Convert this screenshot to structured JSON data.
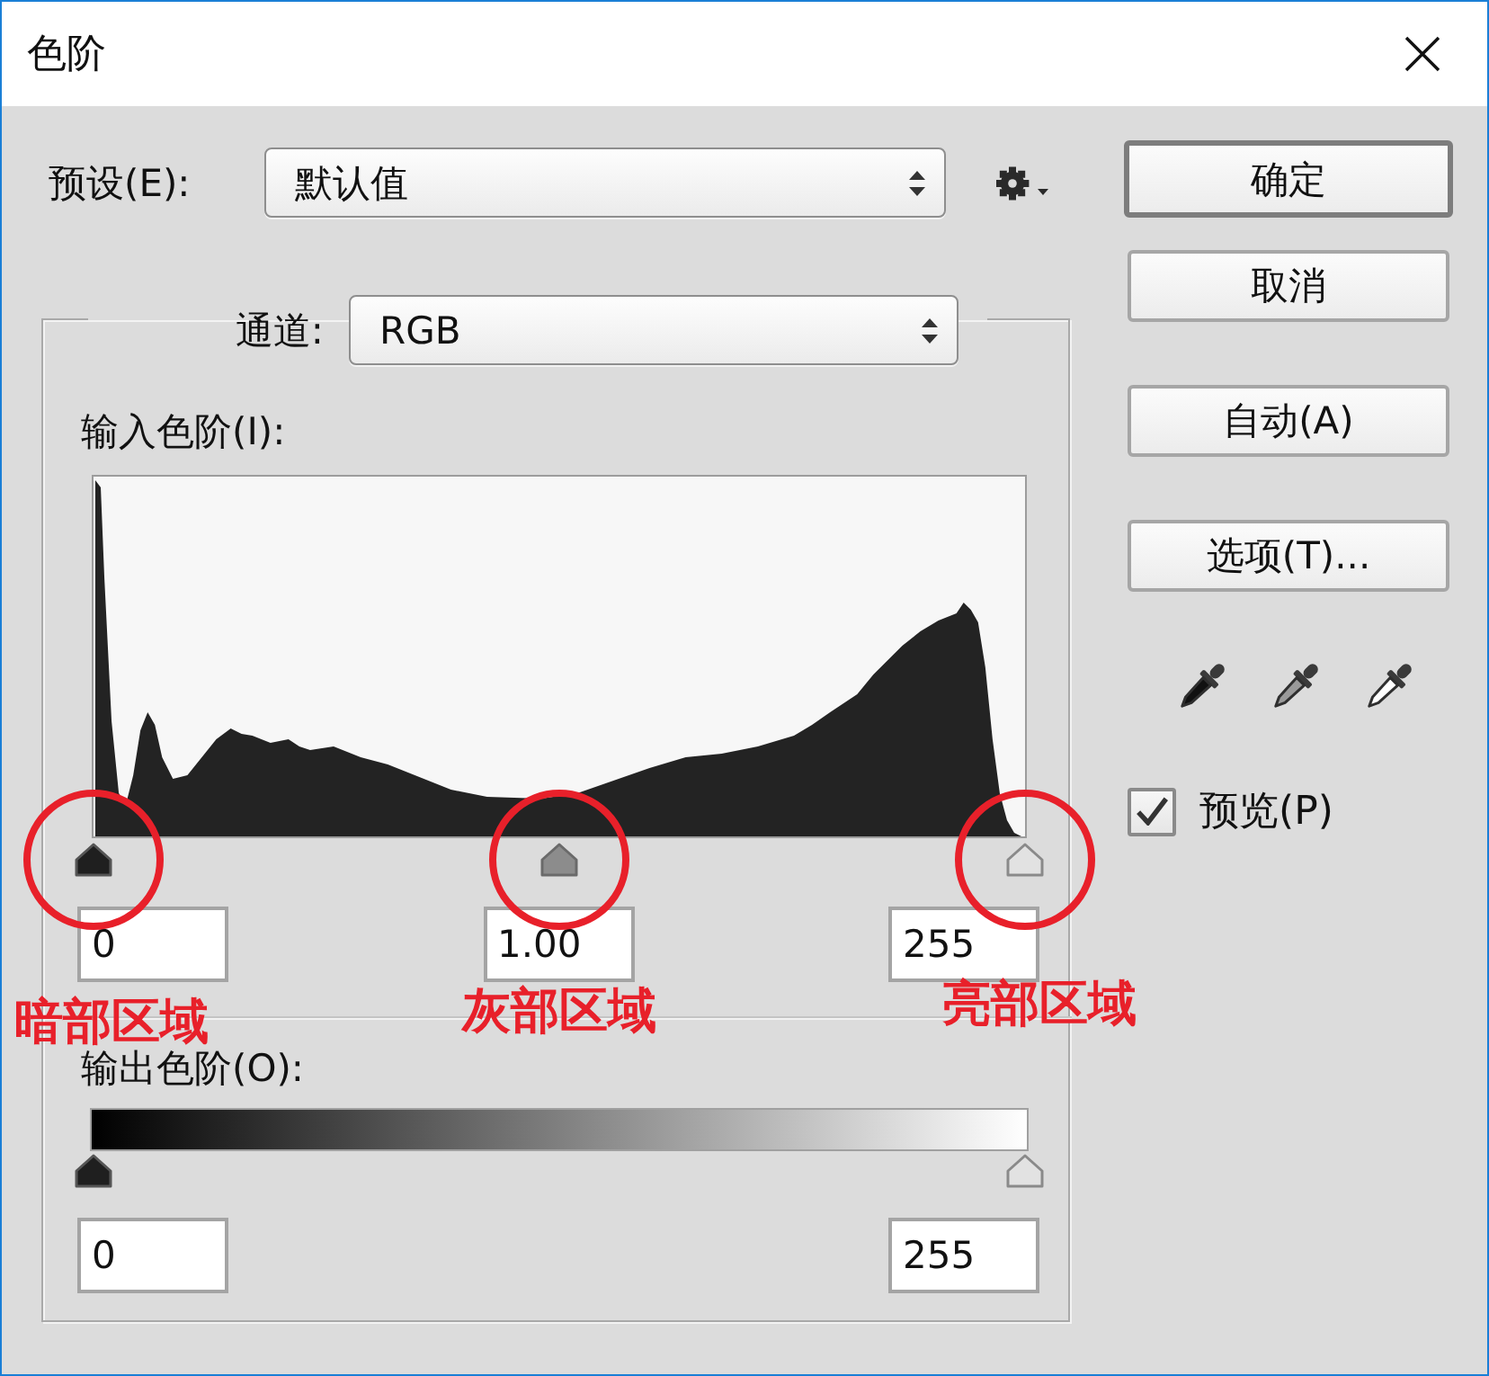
{
  "window": {
    "title": "色阶"
  },
  "preset": {
    "label": "预设(E):",
    "value": "默认值"
  },
  "buttons": [
    {
      "label": "确定",
      "default": true
    },
    {
      "label": "取消",
      "default": false
    },
    {
      "label": "自动(A)",
      "default": false
    },
    {
      "label": "选项(T)...",
      "default": false
    }
  ],
  "channel": {
    "label": "通道:",
    "value": "RGB"
  },
  "input_levels": {
    "label": "输入色阶(I):",
    "handles": [
      {
        "kind": "shadow",
        "level": 0,
        "value": "0",
        "annotation": "暗部区域"
      },
      {
        "kind": "midtone",
        "level": 0.5,
        "value": "1.00",
        "annotation": "灰部区域"
      },
      {
        "kind": "highlight",
        "level": 1,
        "value": "255",
        "annotation": "亮部区域"
      }
    ]
  },
  "eyedroppers": [
    {
      "kind": "shadow"
    },
    {
      "kind": "midtone"
    },
    {
      "kind": "highlight"
    }
  ],
  "preview": {
    "label": "预览(P)",
    "checked": true
  },
  "output_levels": {
    "label": "输出色阶(O):",
    "handles": [
      {
        "kind": "shadow",
        "level": 0,
        "value": "0"
      },
      {
        "kind": "highlight",
        "level": 1,
        "value": "255"
      }
    ]
  }
}
